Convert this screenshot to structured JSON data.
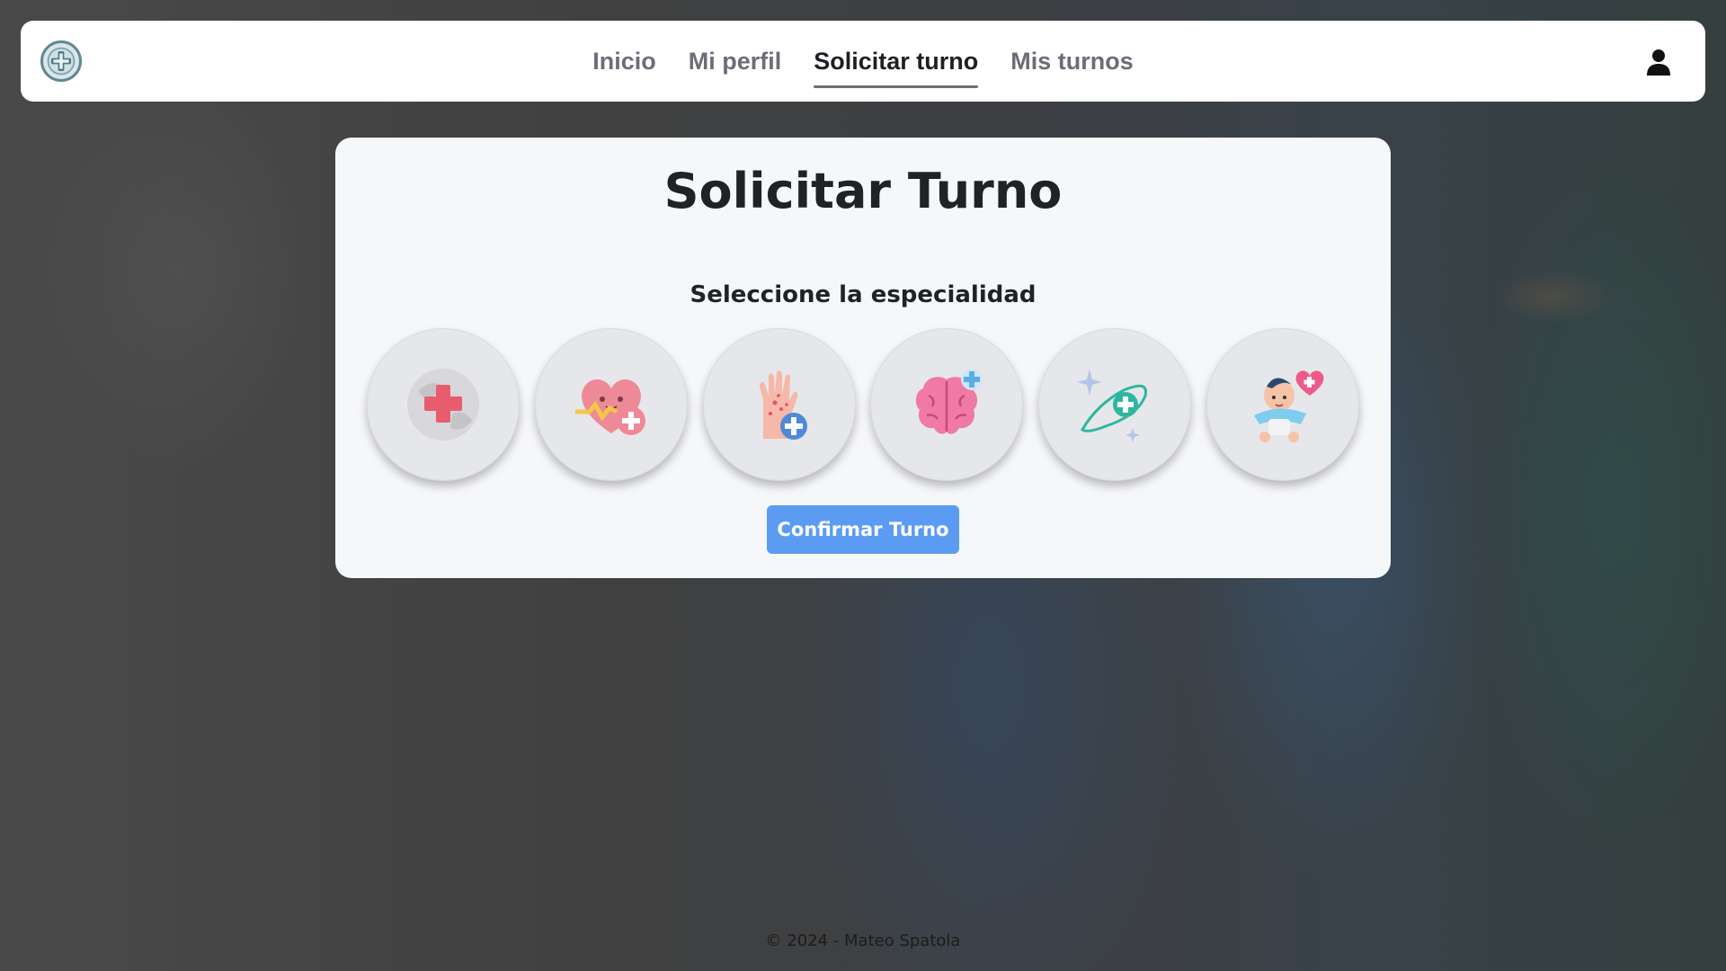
{
  "nav": {
    "links": [
      {
        "label": "Inicio",
        "active": false
      },
      {
        "label": "Mi perfil",
        "active": false
      },
      {
        "label": "Solicitar turno",
        "active": true
      },
      {
        "label": "Mis turnos",
        "active": false
      }
    ],
    "logo_icon": "medical-cross-logo-icon",
    "user_icon": "user-icon"
  },
  "main": {
    "title": "Solicitar Turno",
    "subtitle": "Seleccione la especialidad",
    "specialty_icons": [
      "globe-medical-cross-icon",
      "heart-rate-plus-icon",
      "hand-skin-plus-icon",
      "brain-plus-icon",
      "orbit-sparkle-plus-icon",
      "baby-heart-icon"
    ],
    "confirm_label": "Confirmar Turno"
  },
  "footer": {
    "text": "© 2024 - Mateo Spatola"
  },
  "colors": {
    "primary_button": "#5b9cf2",
    "card_bg": "#f6f7f9",
    "nav_active_text": "#1d1f24",
    "nav_text": "#6b6e76"
  }
}
